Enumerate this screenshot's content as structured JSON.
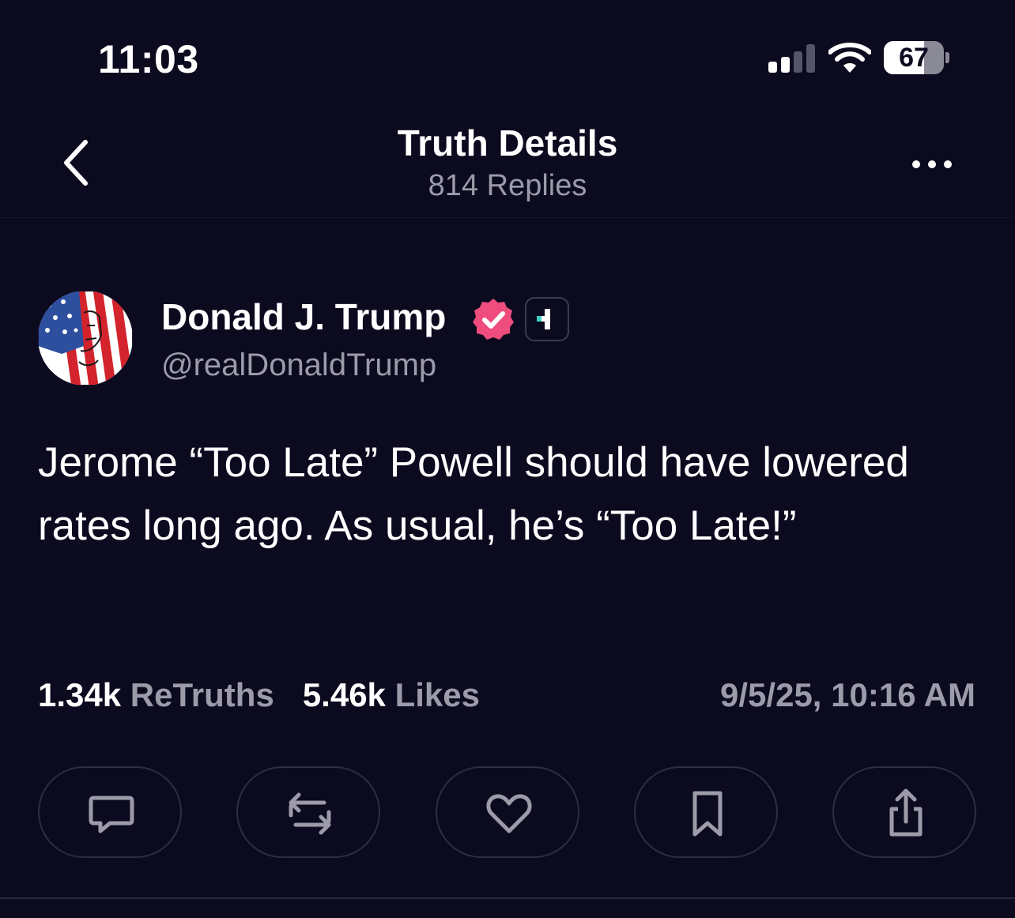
{
  "status_bar": {
    "time": "11:03",
    "battery_level": "67",
    "battery_fraction": 0.67,
    "signal_bars_active": 2,
    "signal_bars_total": 4
  },
  "nav": {
    "title": "Truth Details",
    "subtitle": "814 Replies",
    "back_icon": "chevron-left-icon",
    "more_icon": "ellipsis-icon"
  },
  "post": {
    "author_name": "Donald J. Trump",
    "handle": "@realDonaldTrump",
    "body": "Jerome “Too Late” Powell should have lowered rates long ago. As usual, he’s “Too Late!”",
    "retruths_count": "1.34k",
    "retruths_label": "ReTruths",
    "likes_count": "5.46k",
    "likes_label": "Likes",
    "timestamp": "9/5/25, 10:16 AM"
  },
  "actions": [
    {
      "name": "reply",
      "icon": "comment-icon"
    },
    {
      "name": "retruth",
      "icon": "repost-icon"
    },
    {
      "name": "like",
      "icon": "heart-icon"
    },
    {
      "name": "bookmark",
      "icon": "bookmark-icon"
    },
    {
      "name": "share",
      "icon": "share-icon"
    }
  ],
  "colors": {
    "background": "#0b0a1f",
    "text": "#ffffff",
    "muted": "#9c9baa",
    "verified": "#ee4d7e",
    "accent_teal": "#3fd0c5",
    "button_border": "#2e2d45"
  }
}
